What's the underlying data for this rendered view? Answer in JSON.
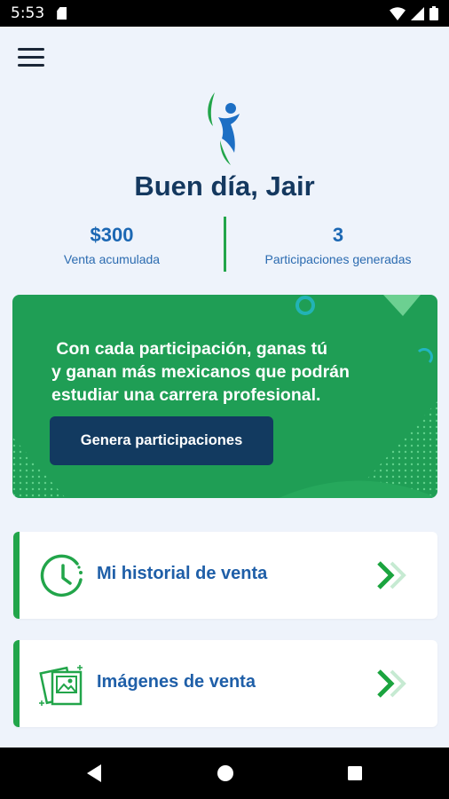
{
  "status_bar": {
    "time": "5:53"
  },
  "header": {
    "menu_icon": "hamburger-menu-icon",
    "logo_icon": "person-leaf-logo"
  },
  "greeting": "Buen día, Jair",
  "stats": {
    "sales": {
      "value": "$300",
      "label": "Venta acumulada"
    },
    "participations": {
      "value": "3",
      "label": "Participaciones generadas"
    }
  },
  "banner": {
    "line1": " Con cada participación, ganas tú",
    "line2": "y ganan más mexicanos que podrán",
    "line3": "estudiar una carrera profesional.",
    "button_label": "Genera participaciones"
  },
  "menu_cards": [
    {
      "label": "Mi historial de venta",
      "icon": "clock-history-icon"
    },
    {
      "label": "Imágenes de venta",
      "icon": "images-icon"
    }
  ],
  "colors": {
    "primary_blue": "#14385f",
    "link_blue": "#1f5fa8",
    "accent_green": "#22a54a",
    "banner_green": "#1f9e55",
    "button_navy": "#123a60",
    "background": "#eef3fb"
  }
}
